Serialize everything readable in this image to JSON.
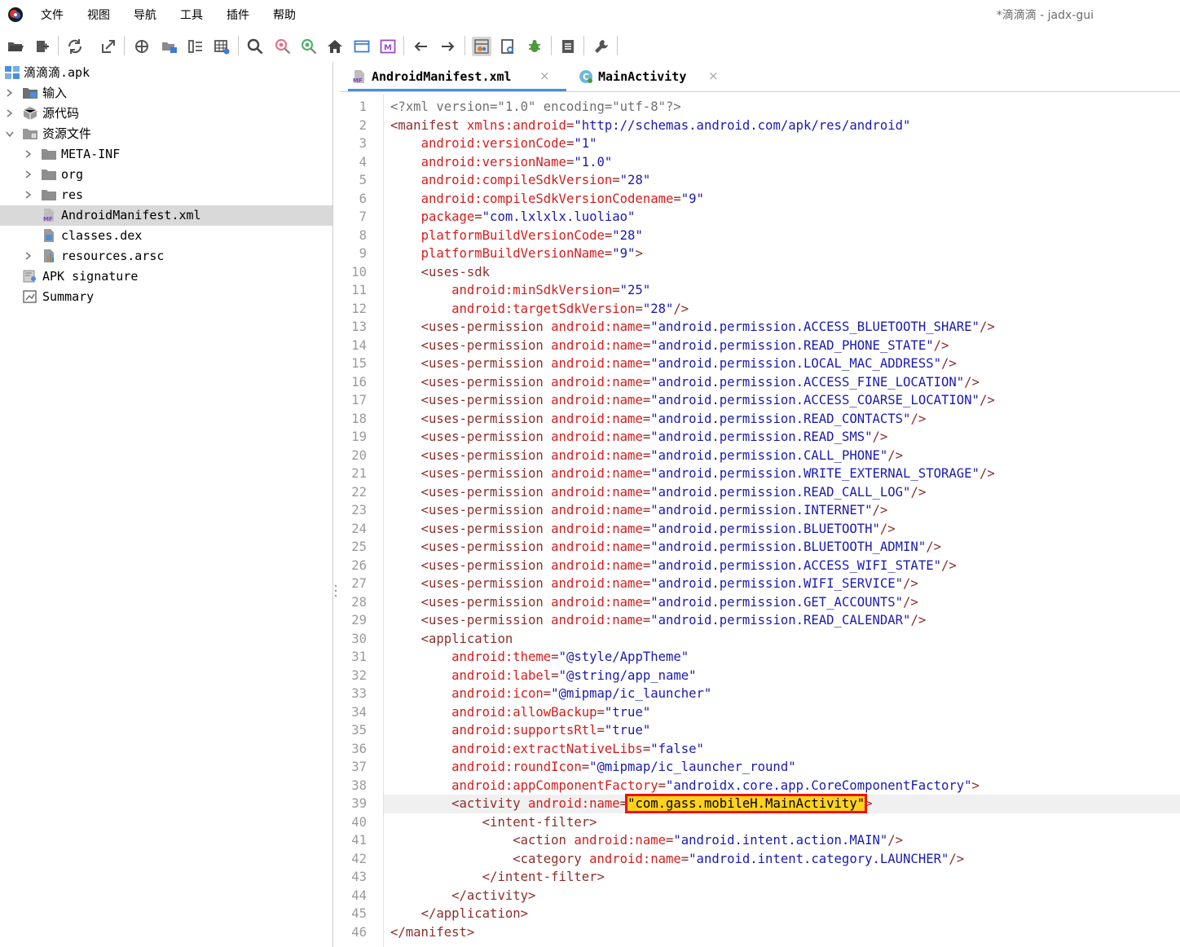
{
  "window": {
    "title": "*滴滴滴 - jadx-gui"
  },
  "menu": {
    "items": [
      "文件",
      "视图",
      "导航",
      "工具",
      "插件",
      "帮助"
    ]
  },
  "toolbar": {
    "buttons": [
      "open-file-icon",
      "add-files-icon",
      "sync-icon",
      "export-icon",
      "crosshair-icon",
      "tree-flatten-icon",
      "deobf-list-icon",
      "table-grid-icon",
      "search-icon",
      "find-usage-icon",
      "search-code-icon",
      "home-icon",
      "window-icon",
      "metadata-icon",
      "back-arrow-icon",
      "forward-arrow-icon",
      "decompile-all-icon",
      "quark-icon",
      "debug-bug-icon",
      "log-icon",
      "wrench-icon"
    ]
  },
  "tree": {
    "items": [
      {
        "label": "滴滴滴.apk"
      },
      {
        "label": "输入"
      },
      {
        "label": "源代码"
      },
      {
        "label": "资源文件"
      },
      {
        "label": "META-INF"
      },
      {
        "label": "org"
      },
      {
        "label": "res"
      },
      {
        "label": "AndroidManifest.xml"
      },
      {
        "label": "classes.dex"
      },
      {
        "label": "resources.arsc"
      },
      {
        "label": "APK signature"
      },
      {
        "label": "Summary"
      }
    ]
  },
  "tabs": [
    {
      "label": "AndroidManifest.xml",
      "icon_text": "MF",
      "close": "×"
    },
    {
      "label": "MainActivity",
      "icon_text": "C",
      "close": "×"
    }
  ],
  "code": {
    "current_line": 39,
    "lines": [
      [
        [
          "decl",
          "<?xml version=\"1.0\" encoding=\"utf-8\"?>"
        ]
      ],
      [
        [
          "tag",
          "<manifest "
        ],
        [
          "attr",
          "xmlns:android"
        ],
        [
          "punct",
          "="
        ],
        [
          "val",
          "\"http://schemas.android.com/apk/res/android\""
        ]
      ],
      [
        [
          "plain",
          "    "
        ],
        [
          "attr",
          "android:versionCode"
        ],
        [
          "punct",
          "="
        ],
        [
          "val",
          "\"1\""
        ]
      ],
      [
        [
          "plain",
          "    "
        ],
        [
          "attr",
          "android:versionName"
        ],
        [
          "punct",
          "="
        ],
        [
          "val",
          "\"1.0\""
        ]
      ],
      [
        [
          "plain",
          "    "
        ],
        [
          "attr",
          "android:compileSdkVersion"
        ],
        [
          "punct",
          "="
        ],
        [
          "val",
          "\"28\""
        ]
      ],
      [
        [
          "plain",
          "    "
        ],
        [
          "attr",
          "android:compileSdkVersionCodename"
        ],
        [
          "punct",
          "="
        ],
        [
          "val",
          "\"9\""
        ]
      ],
      [
        [
          "plain",
          "    "
        ],
        [
          "attr",
          "package"
        ],
        [
          "punct",
          "="
        ],
        [
          "val",
          "\"com.lxlxlx.luoliao\""
        ]
      ],
      [
        [
          "plain",
          "    "
        ],
        [
          "attr",
          "platformBuildVersionCode"
        ],
        [
          "punct",
          "="
        ],
        [
          "val",
          "\"28\""
        ]
      ],
      [
        [
          "plain",
          "    "
        ],
        [
          "attr",
          "platformBuildVersionName"
        ],
        [
          "punct",
          "="
        ],
        [
          "val",
          "\"9\""
        ],
        [
          "punct",
          ">"
        ]
      ],
      [
        [
          "plain",
          "    "
        ],
        [
          "tag",
          "<uses-sdk"
        ]
      ],
      [
        [
          "plain",
          "        "
        ],
        [
          "attr",
          "android:minSdkVersion"
        ],
        [
          "punct",
          "="
        ],
        [
          "val",
          "\"25\""
        ]
      ],
      [
        [
          "plain",
          "        "
        ],
        [
          "attr",
          "android:targetSdkVersion"
        ],
        [
          "punct",
          "="
        ],
        [
          "val",
          "\"28\""
        ],
        [
          "punct",
          "/>"
        ]
      ],
      [
        [
          "plain",
          "    "
        ],
        [
          "tag",
          "<uses-permission "
        ],
        [
          "attr",
          "android:name"
        ],
        [
          "punct",
          "="
        ],
        [
          "val",
          "\"android.permission.ACCESS_BLUETOOTH_SHARE\""
        ],
        [
          "punct",
          "/>"
        ]
      ],
      [
        [
          "plain",
          "    "
        ],
        [
          "tag",
          "<uses-permission "
        ],
        [
          "attr",
          "android:name"
        ],
        [
          "punct",
          "="
        ],
        [
          "val",
          "\"android.permission.READ_PHONE_STATE\""
        ],
        [
          "punct",
          "/>"
        ]
      ],
      [
        [
          "plain",
          "    "
        ],
        [
          "tag",
          "<uses-permission "
        ],
        [
          "attr",
          "android:name"
        ],
        [
          "punct",
          "="
        ],
        [
          "val",
          "\"android.permission.LOCAL_MAC_ADDRESS\""
        ],
        [
          "punct",
          "/>"
        ]
      ],
      [
        [
          "plain",
          "    "
        ],
        [
          "tag",
          "<uses-permission "
        ],
        [
          "attr",
          "android:name"
        ],
        [
          "punct",
          "="
        ],
        [
          "val",
          "\"android.permission.ACCESS_FINE_LOCATION\""
        ],
        [
          "punct",
          "/>"
        ]
      ],
      [
        [
          "plain",
          "    "
        ],
        [
          "tag",
          "<uses-permission "
        ],
        [
          "attr",
          "android:name"
        ],
        [
          "punct",
          "="
        ],
        [
          "val",
          "\"android.permission.ACCESS_COARSE_LOCATION\""
        ],
        [
          "punct",
          "/>"
        ]
      ],
      [
        [
          "plain",
          "    "
        ],
        [
          "tag",
          "<uses-permission "
        ],
        [
          "attr",
          "android:name"
        ],
        [
          "punct",
          "="
        ],
        [
          "val",
          "\"android.permission.READ_CONTACTS\""
        ],
        [
          "punct",
          "/>"
        ]
      ],
      [
        [
          "plain",
          "    "
        ],
        [
          "tag",
          "<uses-permission "
        ],
        [
          "attr",
          "android:name"
        ],
        [
          "punct",
          "="
        ],
        [
          "val",
          "\"android.permission.READ_SMS\""
        ],
        [
          "punct",
          "/>"
        ]
      ],
      [
        [
          "plain",
          "    "
        ],
        [
          "tag",
          "<uses-permission "
        ],
        [
          "attr",
          "android:name"
        ],
        [
          "punct",
          "="
        ],
        [
          "val",
          "\"android.permission.CALL_PHONE\""
        ],
        [
          "punct",
          "/>"
        ]
      ],
      [
        [
          "plain",
          "    "
        ],
        [
          "tag",
          "<uses-permission "
        ],
        [
          "attr",
          "android:name"
        ],
        [
          "punct",
          "="
        ],
        [
          "val",
          "\"android.permission.WRITE_EXTERNAL_STORAGE\""
        ],
        [
          "punct",
          "/>"
        ]
      ],
      [
        [
          "plain",
          "    "
        ],
        [
          "tag",
          "<uses-permission "
        ],
        [
          "attr",
          "android:name"
        ],
        [
          "punct",
          "="
        ],
        [
          "val",
          "\"android.permission.READ_CALL_LOG\""
        ],
        [
          "punct",
          "/>"
        ]
      ],
      [
        [
          "plain",
          "    "
        ],
        [
          "tag",
          "<uses-permission "
        ],
        [
          "attr",
          "android:name"
        ],
        [
          "punct",
          "="
        ],
        [
          "val",
          "\"android.permission.INTERNET\""
        ],
        [
          "punct",
          "/>"
        ]
      ],
      [
        [
          "plain",
          "    "
        ],
        [
          "tag",
          "<uses-permission "
        ],
        [
          "attr",
          "android:name"
        ],
        [
          "punct",
          "="
        ],
        [
          "val",
          "\"android.permission.BLUETOOTH\""
        ],
        [
          "punct",
          "/>"
        ]
      ],
      [
        [
          "plain",
          "    "
        ],
        [
          "tag",
          "<uses-permission "
        ],
        [
          "attr",
          "android:name"
        ],
        [
          "punct",
          "="
        ],
        [
          "val",
          "\"android.permission.BLUETOOTH_ADMIN\""
        ],
        [
          "punct",
          "/>"
        ]
      ],
      [
        [
          "plain",
          "    "
        ],
        [
          "tag",
          "<uses-permission "
        ],
        [
          "attr",
          "android:name"
        ],
        [
          "punct",
          "="
        ],
        [
          "val",
          "\"android.permission.ACCESS_WIFI_STATE\""
        ],
        [
          "punct",
          "/>"
        ]
      ],
      [
        [
          "plain",
          "    "
        ],
        [
          "tag",
          "<uses-permission "
        ],
        [
          "attr",
          "android:name"
        ],
        [
          "punct",
          "="
        ],
        [
          "val",
          "\"android.permission.WIFI_SERVICE\""
        ],
        [
          "punct",
          "/>"
        ]
      ],
      [
        [
          "plain",
          "    "
        ],
        [
          "tag",
          "<uses-permission "
        ],
        [
          "attr",
          "android:name"
        ],
        [
          "punct",
          "="
        ],
        [
          "val",
          "\"android.permission.GET_ACCOUNTS\""
        ],
        [
          "punct",
          "/>"
        ]
      ],
      [
        [
          "plain",
          "    "
        ],
        [
          "tag",
          "<uses-permission "
        ],
        [
          "attr",
          "android:name"
        ],
        [
          "punct",
          "="
        ],
        [
          "val",
          "\"android.permission.READ_CALENDAR\""
        ],
        [
          "punct",
          "/>"
        ]
      ],
      [
        [
          "plain",
          "    "
        ],
        [
          "tag",
          "<application"
        ]
      ],
      [
        [
          "plain",
          "        "
        ],
        [
          "attr",
          "android:theme"
        ],
        [
          "punct",
          "="
        ],
        [
          "val",
          "\"@style/AppTheme\""
        ]
      ],
      [
        [
          "plain",
          "        "
        ],
        [
          "attr",
          "android:label"
        ],
        [
          "punct",
          "="
        ],
        [
          "val",
          "\"@string/app_name\""
        ]
      ],
      [
        [
          "plain",
          "        "
        ],
        [
          "attr",
          "android:icon"
        ],
        [
          "punct",
          "="
        ],
        [
          "val",
          "\"@mipmap/ic_launcher\""
        ]
      ],
      [
        [
          "plain",
          "        "
        ],
        [
          "attr",
          "android:allowBackup"
        ],
        [
          "punct",
          "="
        ],
        [
          "val",
          "\"true\""
        ]
      ],
      [
        [
          "plain",
          "        "
        ],
        [
          "attr",
          "android:supportsRtl"
        ],
        [
          "punct",
          "="
        ],
        [
          "val",
          "\"true\""
        ]
      ],
      [
        [
          "plain",
          "        "
        ],
        [
          "attr",
          "android:extractNativeLibs"
        ],
        [
          "punct",
          "="
        ],
        [
          "val",
          "\"false\""
        ]
      ],
      [
        [
          "plain",
          "        "
        ],
        [
          "attr",
          "android:roundIcon"
        ],
        [
          "punct",
          "="
        ],
        [
          "val",
          "\"@mipmap/ic_launcher_round\""
        ]
      ],
      [
        [
          "plain",
          "        "
        ],
        [
          "attr",
          "android:appComponentFactory"
        ],
        [
          "punct",
          "="
        ],
        [
          "val",
          "\"androidx.core.app.CoreComponentFactory\""
        ],
        [
          "punct",
          ">"
        ]
      ],
      [
        [
          "plain",
          "        "
        ],
        [
          "tag",
          "<activity "
        ],
        [
          "attr",
          "android:name"
        ],
        [
          "punct",
          "="
        ],
        [
          "hl",
          "\"com.gass.mobileH.MainActivity\""
        ],
        [
          "punct",
          ">"
        ]
      ],
      [
        [
          "plain",
          "            "
        ],
        [
          "tag",
          "<intent-filter>"
        ]
      ],
      [
        [
          "plain",
          "                "
        ],
        [
          "tag",
          "<action "
        ],
        [
          "attr",
          "android:name"
        ],
        [
          "punct",
          "="
        ],
        [
          "val",
          "\"android.intent.action.MAIN\""
        ],
        [
          "punct",
          "/>"
        ]
      ],
      [
        [
          "plain",
          "                "
        ],
        [
          "tag",
          "<category "
        ],
        [
          "attr",
          "android:name"
        ],
        [
          "punct",
          "="
        ],
        [
          "val",
          "\"android.intent.category.LAUNCHER\""
        ],
        [
          "punct",
          "/>"
        ]
      ],
      [
        [
          "plain",
          "            "
        ],
        [
          "tag",
          "</intent-filter>"
        ]
      ],
      [
        [
          "plain",
          "        "
        ],
        [
          "tag",
          "</activity>"
        ]
      ],
      [
        [
          "plain",
          "    "
        ],
        [
          "tag",
          "</application>"
        ]
      ],
      [
        [
          "tag",
          "</manifest>"
        ]
      ]
    ]
  }
}
